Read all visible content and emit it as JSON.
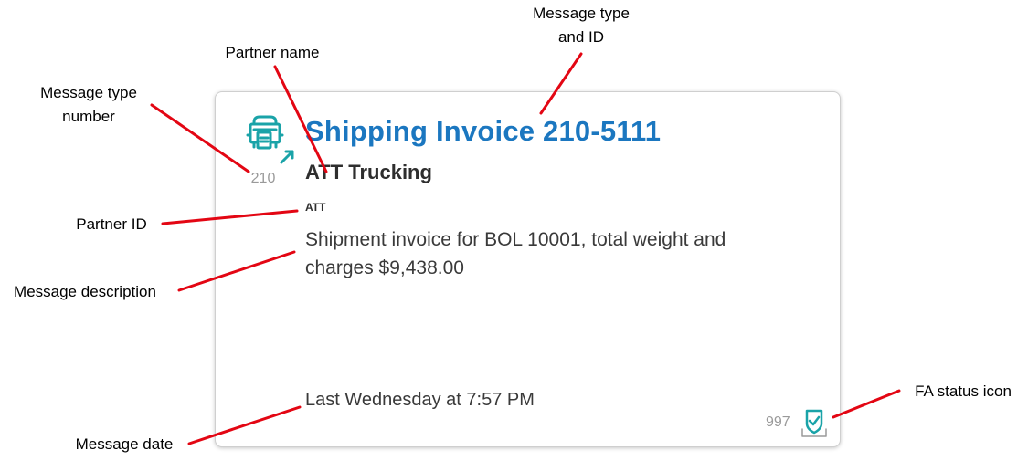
{
  "annotations": {
    "message_type_and_id_line1": "Message type",
    "message_type_and_id_line2": "and ID",
    "partner_name": "Partner name",
    "message_type_number_line1": "Message type",
    "message_type_number_line2": "number",
    "partner_id": "Partner ID",
    "message_description": "Message description",
    "message_date": "Message date",
    "fa_status_icon": "FA status icon"
  },
  "card": {
    "type_icon": "truck-outbound-icon",
    "type_number": "210",
    "title": "Shipping Invoice 210-5111",
    "partner_name": "ATT Trucking",
    "partner_id": "ATT",
    "description": "Shipment invoice for BOL 10001, total weight and charges $9,438.00",
    "date": "Last Wednesday at 7:57 PM",
    "fa_code": "997",
    "fa_icon": "fa-accepted-check-icon"
  },
  "colors": {
    "title": "#1b77c0",
    "icon_teal": "#1aa3a8",
    "leader_lines": "#e30613",
    "muted": "#9a9a9a"
  }
}
